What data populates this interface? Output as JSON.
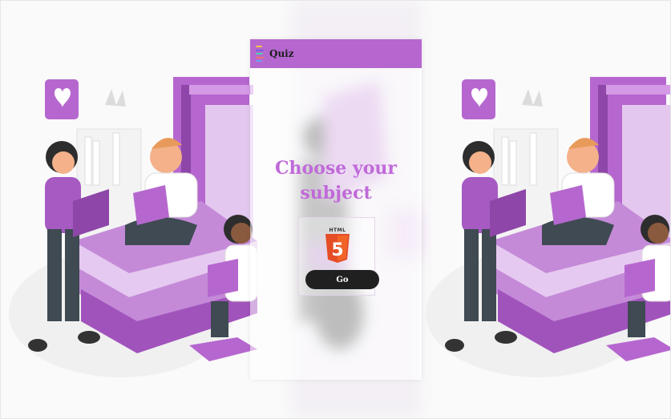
{
  "header": {
    "brand": "Quiz",
    "logo_colors": [
      "#f5c542",
      "#7a5ae0",
      "#4ad0a8",
      "#f07070",
      "#6aa0f0"
    ]
  },
  "main": {
    "heading": "Choose your subject",
    "subjects": [
      {
        "badge_text": "HTML",
        "numeral": "5",
        "button_label": "Go",
        "icon": "html5-icon"
      }
    ]
  },
  "colors": {
    "accent": "#b667cf",
    "heading": "#c06ad9",
    "button": "#202020"
  }
}
